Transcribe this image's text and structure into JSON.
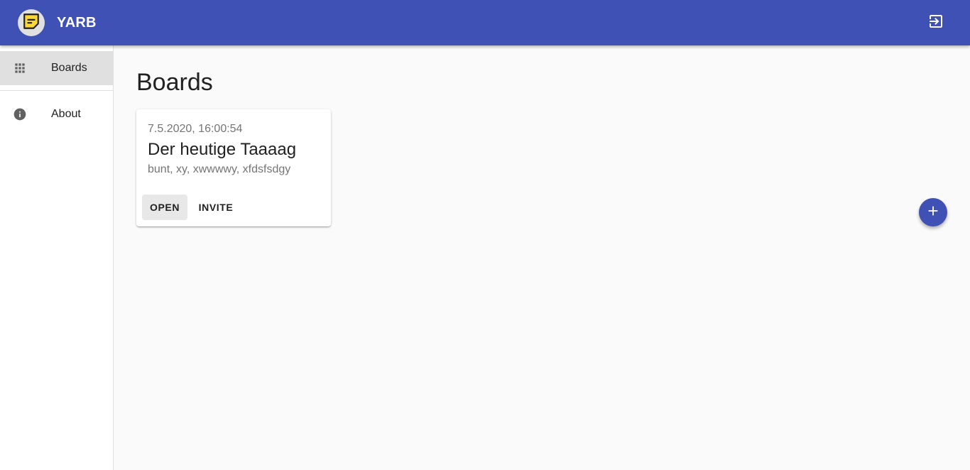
{
  "app": {
    "title": "YARB",
    "logo_icon": "note-icon",
    "logout_icon": "exit-icon",
    "brand_color": "#3f51b5",
    "logo_color": "#fdd835"
  },
  "sidebar": {
    "items": [
      {
        "label": "Boards",
        "icon": "apps-grid-icon",
        "active": true
      },
      {
        "label": "About",
        "icon": "info-icon",
        "active": false
      }
    ]
  },
  "main": {
    "title": "Boards",
    "boards": [
      {
        "date": "7.5.2020, 16:00:54",
        "title": "Der heutige Taaaag",
        "tags": "bunt, xy, xwwwwy, xfdsfsdgy",
        "actions": {
          "open_label": "OPEN",
          "invite_label": "INVITE"
        }
      }
    ],
    "fab_icon": "add-icon"
  }
}
